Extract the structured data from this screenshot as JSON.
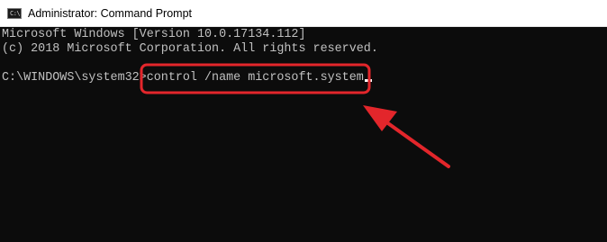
{
  "window": {
    "title": "Administrator: Command Prompt",
    "icon": "command-prompt-icon",
    "icon_glyph": "C:\\."
  },
  "console": {
    "lines": [
      "Microsoft Windows [Version 10.0.17134.112]",
      "(c) 2018 Microsoft Corporation. All rights reserved.",
      ""
    ],
    "prompt": "C:\\WINDOWS\\system32>",
    "command": "control /name microsoft.system"
  },
  "colors": {
    "console_bg": "#0c0c0c",
    "console_text": "#c0c0c0",
    "highlight": "#e3262b"
  }
}
